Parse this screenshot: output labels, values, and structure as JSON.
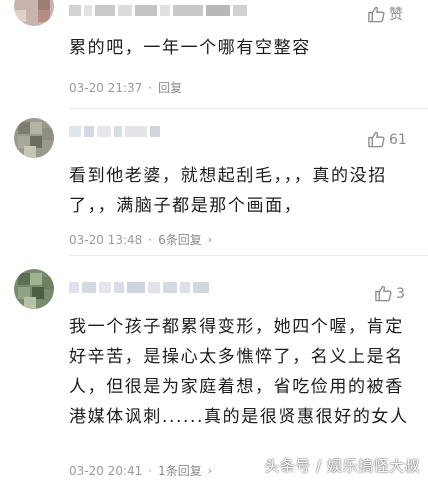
{
  "comments": [
    {
      "likes": "赞",
      "text": "累的吧，一年一个哪有空整容",
      "time": "03-20 21:37",
      "sep": "·",
      "reply": "回复",
      "chevron": ""
    },
    {
      "likes": "61",
      "text": "看到他老婆，就想起刮毛，，，真的没招了，，满脑子都是那个画面，",
      "time": "03-20 13:48",
      "sep": "·",
      "reply": "6条回复",
      "chevron": "›"
    },
    {
      "likes": "3",
      "text": "我一个孩子都累得变形，她四个喔，肯定好辛苦，是操心太多憔悴了，名义上是名人，但很是为家庭着想，省吃俭用的被香港媒体讽刺......真的是很贤惠很好的女人",
      "time": "03-20 20:41",
      "sep": "·",
      "reply": "1条回复",
      "chevron": "›"
    }
  ],
  "watermark": "头条号 / 娱乐搞怪大叔",
  "icons": {
    "like": "thumbs-up-icon",
    "chevron": "chevron-right-icon"
  },
  "colors": {
    "meta": "#9a9a9a",
    "text": "#1c1c1c",
    "like": "#8a8a8a"
  }
}
